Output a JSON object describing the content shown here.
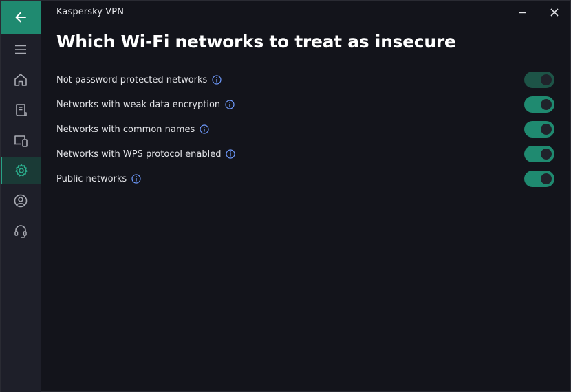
{
  "window": {
    "title": "Kaspersky VPN"
  },
  "page": {
    "title": "Which Wi-Fi networks to treat as insecure"
  },
  "settings": [
    {
      "label": "Not password protected networks",
      "enabled": true
    },
    {
      "label": "Networks with weak data encryption",
      "enabled": true
    },
    {
      "label": "Networks with common names",
      "enabled": true
    },
    {
      "label": "Networks with WPS protocol enabled",
      "enabled": true
    },
    {
      "label": "Public networks",
      "enabled": true
    }
  ],
  "sidebar": {
    "items": [
      {
        "icon": "menu-icon"
      },
      {
        "icon": "home-icon"
      },
      {
        "icon": "report-icon"
      },
      {
        "icon": "devices-icon"
      },
      {
        "icon": "gear-icon",
        "active": true
      },
      {
        "icon": "account-icon"
      },
      {
        "icon": "headset-icon"
      }
    ]
  },
  "colors": {
    "accent": "#1f8a70",
    "background": "#13141b",
    "sidebar": "#1e1f29",
    "info": "#6f9bff"
  }
}
